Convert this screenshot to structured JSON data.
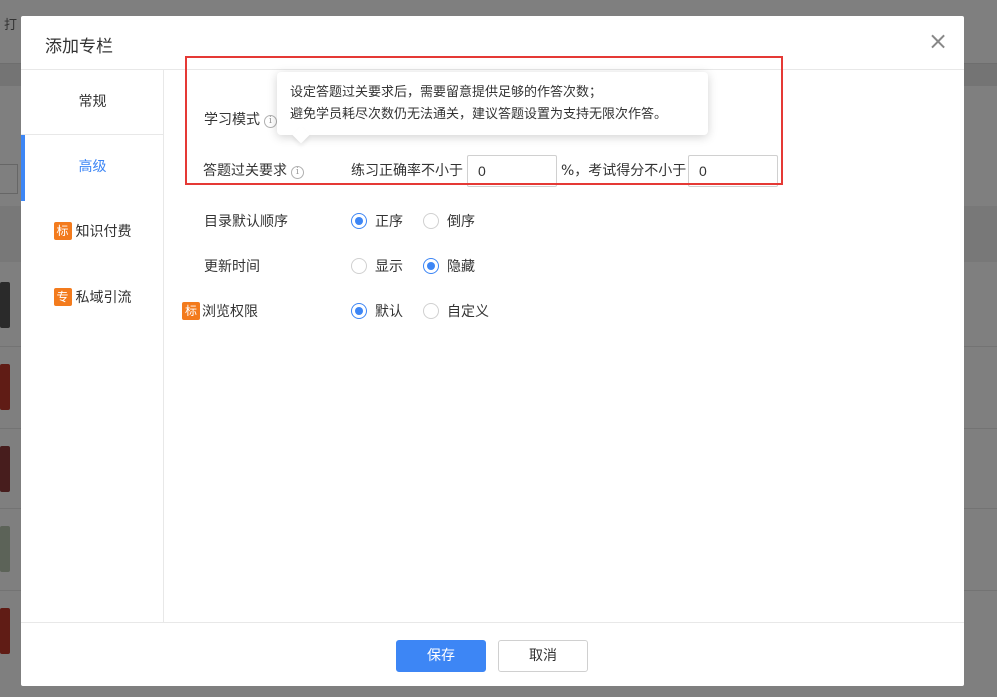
{
  "background": {
    "top_text": "打"
  },
  "dialog": {
    "title": "添加专栏",
    "close_symbol": "×"
  },
  "nav": {
    "items": [
      {
        "label": "常规",
        "active": false,
        "badge": ""
      },
      {
        "label": "高级",
        "active": true,
        "badge": ""
      },
      {
        "label": "知识付费",
        "active": false,
        "badge": "标"
      },
      {
        "label": "私域引流",
        "active": false,
        "badge": "专"
      }
    ]
  },
  "form": {
    "study_mode": {
      "label": "学习模式",
      "icon": "info-icon"
    },
    "pass_requirement": {
      "label": "答题过关要求",
      "icon": "info-icon",
      "practice_text": "练习正确率不小于",
      "practice_value": "0",
      "percent_text": "%，考试得分不小于",
      "exam_value": "0"
    },
    "catalog_order": {
      "label": "目录默认顺序",
      "options": [
        {
          "label": "正序",
          "checked": true
        },
        {
          "label": "倒序",
          "checked": false
        }
      ]
    },
    "update_time": {
      "label": "更新时间",
      "options": [
        {
          "label": "显示",
          "checked": false
        },
        {
          "label": "隐藏",
          "checked": true
        }
      ]
    },
    "browse_permission": {
      "badge": "标",
      "label": "浏览权限",
      "options": [
        {
          "label": "默认",
          "checked": true
        },
        {
          "label": "自定义",
          "checked": false
        }
      ]
    }
  },
  "tooltip": {
    "line1": "设定答题过关要求后，需要留意提供足够的作答次数；",
    "line2": "避免学员耗尽次数仍无法通关，建议答题设置为支持无限次作答。"
  },
  "footer": {
    "save_label": "保存",
    "cancel_label": "取消"
  },
  "colors": {
    "primary": "#3d86f5",
    "badge": "#f37b1d",
    "highlight": "#e53935"
  }
}
